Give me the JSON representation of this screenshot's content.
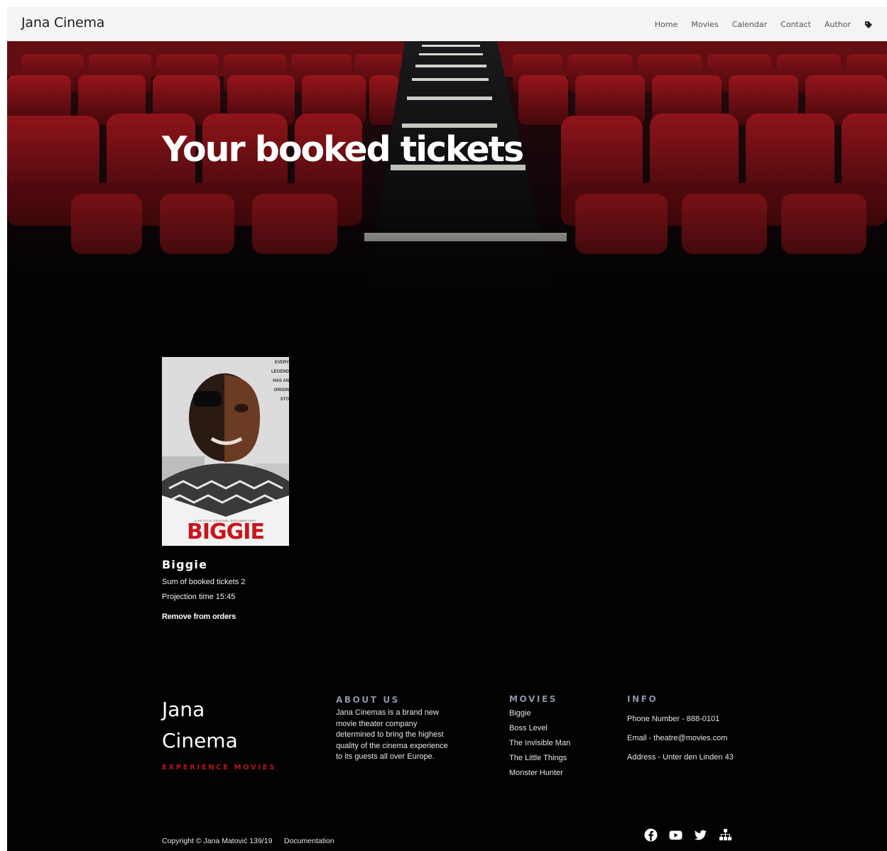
{
  "nav": {
    "brand": "Jana Cinema",
    "links": [
      "Home",
      "Movies",
      "Calendar",
      "Contact",
      "Author"
    ],
    "tag_icon": "tag-icon"
  },
  "hero": {
    "title": "Your booked tickets"
  },
  "ticket": {
    "poster": {
      "word": "BIGGIE",
      "tagline": [
        "EVERY",
        "LEGEND",
        "HAS  AN",
        "ORIGIN",
        "STO"
      ],
      "small": "A NETFLIX ORIGINAL DOCUMENTARY"
    },
    "movie_title": "Biggie",
    "sum_line": "Sum of booked tickets 2",
    "time_line": "Projection time 15:45",
    "remove_label": "Remove from orders"
  },
  "footer": {
    "brand_line1": "Jana",
    "brand_line2": "Cinema",
    "slogan": "EXPERIENCE MOVIES",
    "about_heading": "ABOUT US",
    "about_text": "Jana Cinemas is a brand new movie theater company determined to bring the highest quality of the cinema experience to its guests all over Europe.",
    "movies_heading": "MOVIES",
    "movies": [
      "Biggie",
      "Boss Level",
      "The Invisible Man",
      "The Little Things",
      "Monster Hunter"
    ],
    "info_heading": "INFO",
    "info": [
      "Phone Number  -  888-0101",
      "Email  -  theatre@movies.com",
      "Address  -  Unter den Linden 43"
    ],
    "copyright": "Copyright © Jana Matović 139/19",
    "documentation": "Documentation",
    "social_icons": [
      "facebook-icon",
      "youtube-icon",
      "twitter-icon",
      "sitemap-icon"
    ]
  },
  "colors": {
    "page_bg": "#020203",
    "nav_bg": "#f4f4f2",
    "seat_red": "#8e1419",
    "slogan_red": "#b8141b",
    "heading_gray": "#8a93a6"
  }
}
